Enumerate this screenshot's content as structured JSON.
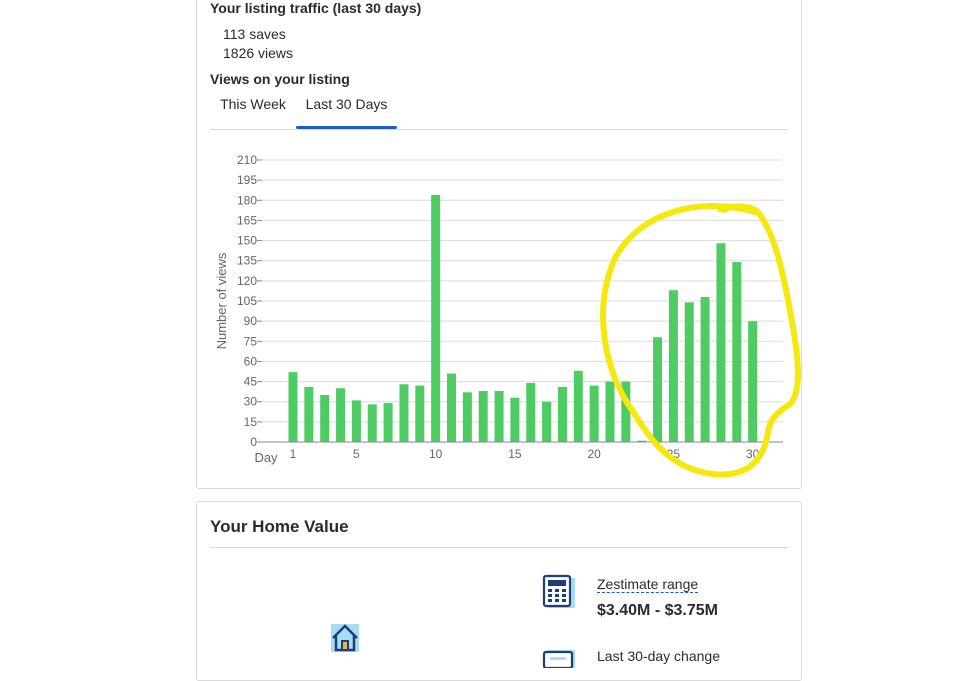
{
  "traffic": {
    "heading": "Your listing traffic (last 30 days)",
    "saves": "113 saves",
    "views": "1826 views",
    "chart_heading": "Views on your listing",
    "tabs": [
      {
        "label": "This Week",
        "active": false
      },
      {
        "label": "Last 30 Days",
        "active": true
      }
    ]
  },
  "chart_data": {
    "type": "bar",
    "xlabel": "Day",
    "ylabel": "Number of views",
    "ylim": [
      0,
      210
    ],
    "yticks": [
      0,
      15,
      30,
      45,
      60,
      75,
      90,
      105,
      120,
      135,
      150,
      165,
      180,
      195,
      210
    ],
    "xticks": [
      1,
      5,
      10,
      15,
      20,
      25,
      30
    ],
    "x": [
      1,
      2,
      3,
      4,
      5,
      6,
      7,
      8,
      9,
      10,
      11,
      12,
      13,
      14,
      15,
      16,
      17,
      18,
      19,
      20,
      21,
      22,
      23,
      24,
      25,
      26,
      27,
      28,
      29,
      30
    ],
    "values": [
      52,
      41,
      35,
      40,
      31,
      28,
      29,
      43,
      42,
      184,
      51,
      37,
      38,
      38,
      33,
      44,
      30,
      41,
      53,
      42,
      45,
      45,
      1,
      78,
      113,
      104,
      108,
      148,
      134,
      90
    ],
    "bar_color": "#4ecb62",
    "grid": true,
    "annotation": {
      "shape": "freehand-circle",
      "color": "#f4e80e",
      "days": [
        24,
        30
      ]
    }
  },
  "home_value": {
    "heading": "Your Home Value",
    "zestimate_label": "Zestimate range",
    "zestimate_value": "$3.40M - $3.75M",
    "change_label": "Last 30-day change"
  },
  "icons": [
    "house-icon",
    "calculator-icon",
    "calendar-icon"
  ]
}
